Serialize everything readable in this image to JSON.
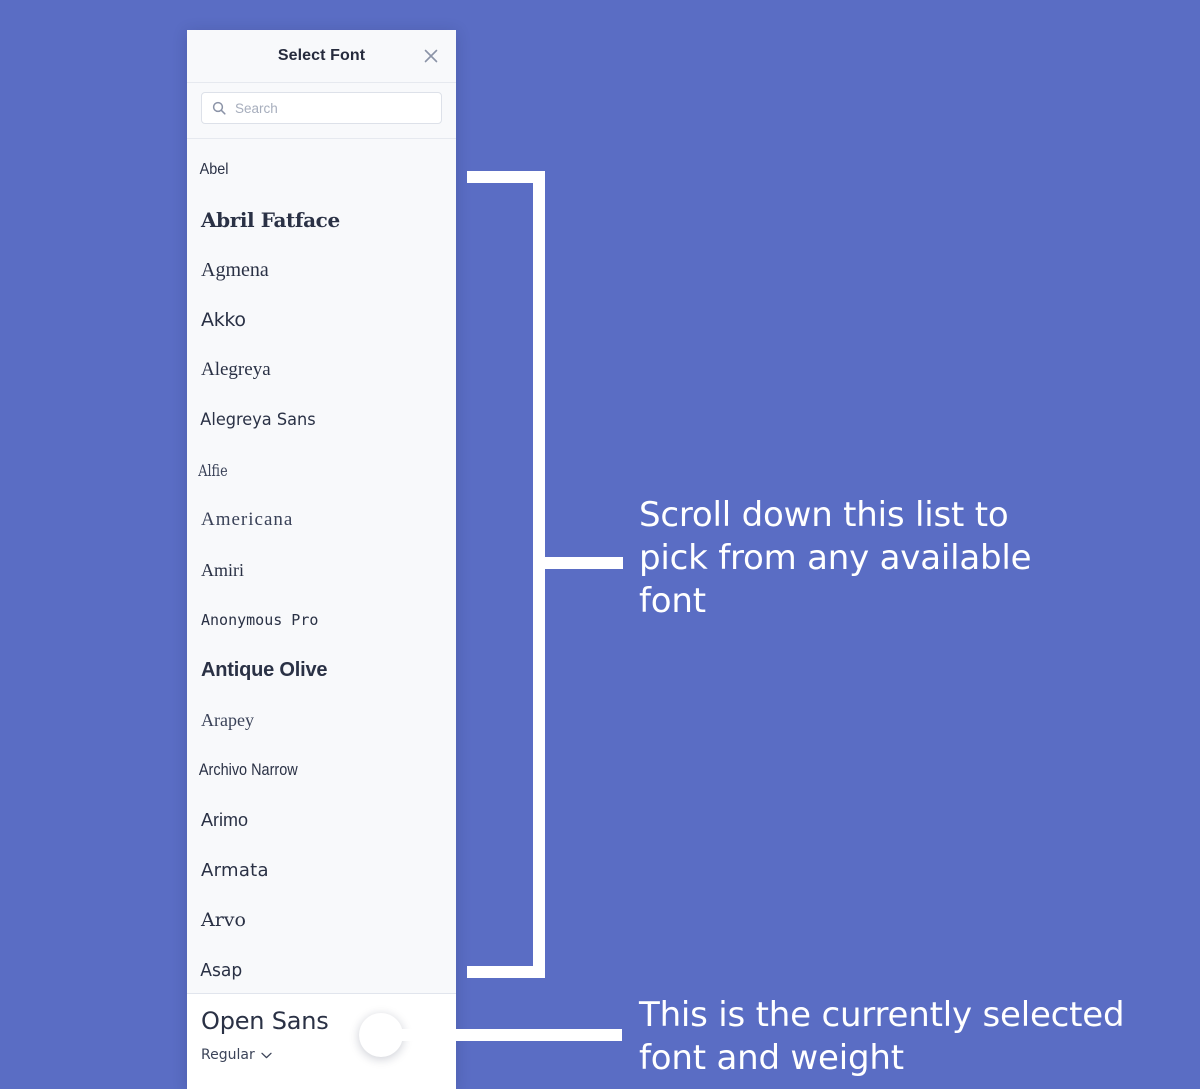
{
  "theme": {
    "background": "#5a6dc4",
    "panel_background": "#f8f9fb",
    "footer_background": "#ffffff",
    "text_primary": "#2a3145",
    "annotation_color": "#ffffff"
  },
  "panel": {
    "title": "Select Font",
    "close_icon": "close-icon",
    "search": {
      "icon": "search-icon",
      "placeholder": "Search",
      "value": ""
    },
    "fonts": [
      {
        "name": "Abel",
        "style_class": "f-abel"
      },
      {
        "name": "Abril Fatface",
        "style_class": "f-abrilfatface"
      },
      {
        "name": "Agmena",
        "style_class": "f-agmena"
      },
      {
        "name": "Akko",
        "style_class": "f-akko"
      },
      {
        "name": "Alegreya",
        "style_class": "f-alegreya"
      },
      {
        "name": "Alegreya Sans",
        "style_class": "f-alegreyasans"
      },
      {
        "name": "Alfie",
        "style_class": "f-alfie"
      },
      {
        "name": "Americana",
        "style_class": "f-americana"
      },
      {
        "name": "Amiri",
        "style_class": "f-amiri"
      },
      {
        "name": "Anonymous Pro",
        "style_class": "f-anonymouspro"
      },
      {
        "name": "Antique Olive",
        "style_class": "f-antiqueolive"
      },
      {
        "name": "Arapey",
        "style_class": "f-arapey"
      },
      {
        "name": "Archivo Narrow",
        "style_class": "f-archivonarrow"
      },
      {
        "name": "Arimo",
        "style_class": "f-arimo"
      },
      {
        "name": "Armata",
        "style_class": "f-armata"
      },
      {
        "name": "Arvo",
        "style_class": "f-arvo"
      },
      {
        "name": "Asap",
        "style_class": "f-asap"
      }
    ],
    "footer": {
      "selected_font": "Open Sans",
      "selected_weight": "Regular",
      "weight_caret_icon": "chevron-down-icon"
    }
  },
  "annotations": {
    "list_callout": "Scroll down this list to pick from any available font",
    "selected_callout": "This is the currently selected font and weight"
  }
}
